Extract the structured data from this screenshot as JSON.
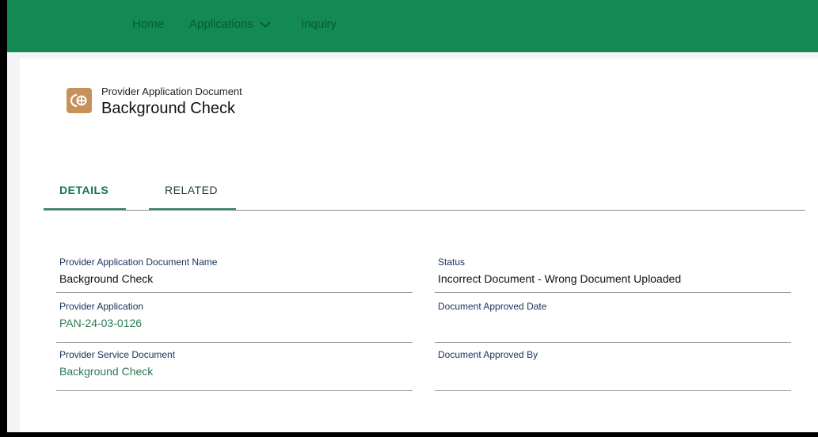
{
  "nav": {
    "home": "Home",
    "applications": "Applications",
    "inquiry": "Inquiry"
  },
  "record": {
    "object_type": "Provider Application Document",
    "title": "Background Check",
    "icon": "document-icon"
  },
  "tabs": [
    {
      "label": "DETAILS",
      "active": true
    },
    {
      "label": "RELATED",
      "active": false
    }
  ],
  "fields": {
    "name": {
      "label": "Provider Application Document Name",
      "value": "Background Check"
    },
    "application": {
      "label": "Provider Application",
      "value": "PAN-24-03-0126"
    },
    "service_doc": {
      "label": "Provider Service Document",
      "value": "Background Check"
    },
    "status": {
      "label": "Status",
      "value": "Incorrect Document - Wrong Document Uploaded"
    },
    "approved_date": {
      "label": "Document Approved Date",
      "value": ""
    },
    "approved_by": {
      "label": "Document Approved By",
      "value": ""
    }
  },
  "colors": {
    "header": "#128a52",
    "accent": "#12784a",
    "icon_bg": "#c8915a"
  }
}
